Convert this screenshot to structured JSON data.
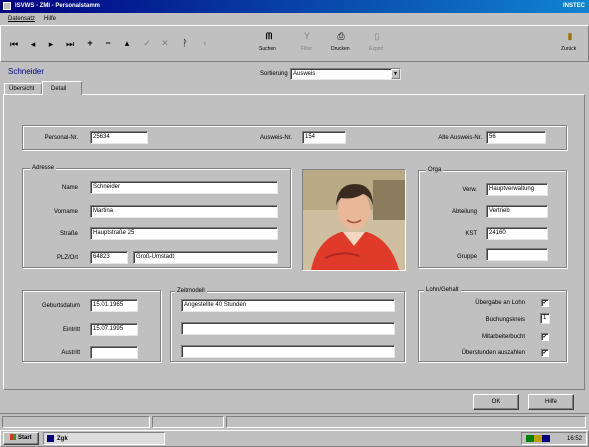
{
  "titlebar": {
    "title": "ISVWS - ZMI - Personalstamm",
    "company": "INSTEC"
  },
  "menubar": {
    "items": [
      "Datensatz",
      "Hilfe"
    ]
  },
  "toolbar": {
    "search_label": "Suchen",
    "filter_label": "Filter",
    "print_label": "Drucken",
    "export_label": "Export",
    "exit_label": "Zurück"
  },
  "header": {
    "employee_name": "Schneider",
    "sort_label": "Sortierung",
    "sort_value": "Ausweis"
  },
  "tabs": [
    "Übersicht",
    "Detail"
  ],
  "ids": {
    "personnel_no_label": "Personal-Nr.",
    "personnel_no": "25634",
    "badge_no_label": "Ausweis-Nr.",
    "badge_no": "154",
    "old_badge_label": "Alte Ausweis-Nr.",
    "old_badge": "56"
  },
  "address": {
    "group_title": "Adresse",
    "name_label": "Name",
    "name": "Schneider",
    "firstname_label": "Vorname",
    "firstname": "Martina",
    "street_label": "Straße",
    "street": "Hauptstraße 25",
    "zip_label": "PLZ/Ort",
    "zip": "64823",
    "city": "Groß-Umstadt"
  },
  "org": {
    "group_title": "Orga",
    "work_label": "Verw.",
    "work": "Hauptverwaltung",
    "dept_label": "Abteilung",
    "dept": "Vertrieb",
    "cost_label": "KST",
    "cost": "24160",
    "group_label": "Gruppe",
    "group": ""
  },
  "dates": {
    "birth_label": "Geburtsdatum",
    "birth": "15.01.1965",
    "entry_label": "Eintritt",
    "entry": "15.07.1995",
    "exit_label": "Austritt",
    "exit": ""
  },
  "time_model": {
    "group_title": "Zeitmodell",
    "line1": "Angestellte 40 Stunden",
    "line2": "",
    "line3": ""
  },
  "payroll": {
    "group_title": "Lohn/Gehalt",
    "transfer_label": "Übergabe an Lohn",
    "transfer_checked": "✓",
    "booking_label": "Buchungskreis",
    "booking_value": "1",
    "staff_label": "Mitarbeiterbucht",
    "staff_checked": "✓",
    "overtime_label": "Überstunden auszahlen",
    "overtime_checked": "✓"
  },
  "buttons": {
    "ok": "OK",
    "help": "Hilfe"
  },
  "taskbar": {
    "start": "Start",
    "task": "Zgk",
    "clock": "16:52"
  },
  "colors": {
    "titlebar_start": "#000080",
    "titlebar_end": "#1084d0",
    "face": "#c0c0c0",
    "name_text": "#000080"
  }
}
